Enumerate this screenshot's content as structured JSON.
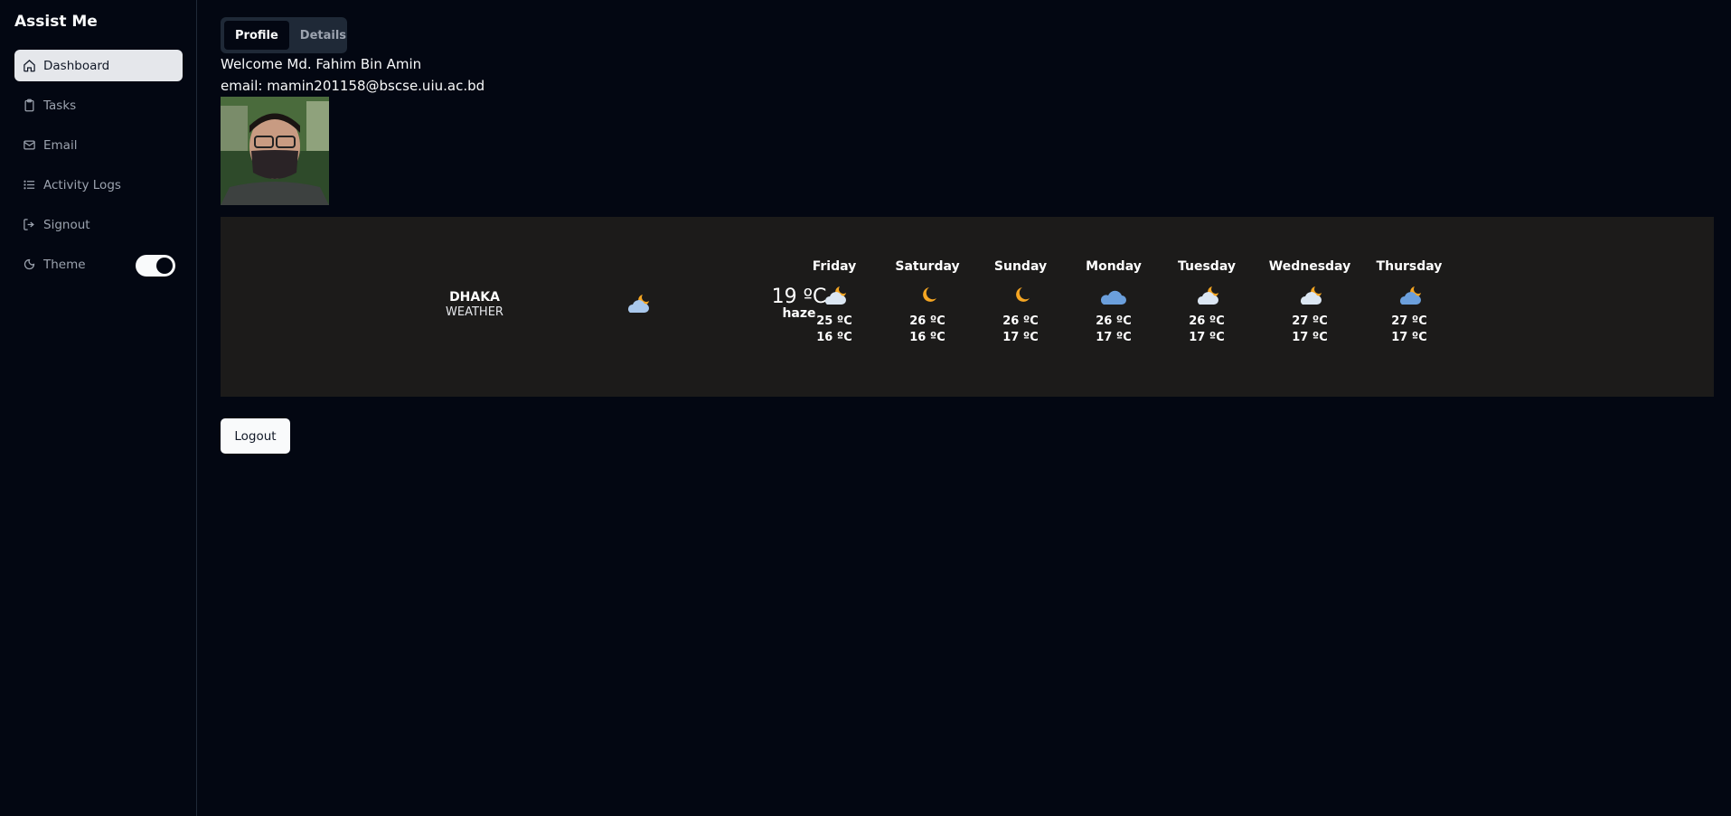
{
  "app": {
    "title": "Assist Me"
  },
  "sidebar": {
    "items": [
      {
        "label": "Dashboard",
        "icon": "home-icon",
        "active": true
      },
      {
        "label": "Tasks",
        "icon": "clipboard-icon"
      },
      {
        "label": "Email",
        "icon": "mail-icon"
      },
      {
        "label": "Activity Logs",
        "icon": "list-icon"
      },
      {
        "label": "Signout",
        "icon": "logout-icon"
      }
    ],
    "theme": {
      "label": "Theme",
      "icon": "moon-sun-icon",
      "enabled": true
    }
  },
  "tabs": [
    {
      "label": "Profile",
      "active": true
    },
    {
      "label": "Details"
    }
  ],
  "profile": {
    "welcome": "Welcome Md. Fahim Bin Amin",
    "email": "email: mamin201158@bscse.uiu.ac.bd"
  },
  "weather": {
    "city": "DHAKA",
    "subtitle": "WEATHER",
    "current": {
      "temp": "19 ºC",
      "description": "haze",
      "icon": "cloud-moon-icon"
    },
    "forecast": [
      {
        "day": "Friday",
        "high": "25 ºC",
        "low": "16 ºC",
        "icon": "cloud-moon-icon"
      },
      {
        "day": "Saturday",
        "high": "26 ºC",
        "low": "16 ºC",
        "icon": "moon-icon"
      },
      {
        "day": "Sunday",
        "high": "26 ºC",
        "low": "17 ºC",
        "icon": "moon-icon"
      },
      {
        "day": "Monday",
        "high": "26 ºC",
        "low": "17 ºC",
        "icon": "cloud-icon"
      },
      {
        "day": "Tuesday",
        "high": "26 ºC",
        "low": "17 ºC",
        "icon": "cloud-moon-icon"
      },
      {
        "day": "Wednesday",
        "high": "27 ºC",
        "low": "17 ºC",
        "icon": "cloud-moon-icon"
      },
      {
        "day": "Thursday",
        "high": "27 ºC",
        "low": "17 ºC",
        "icon": "cloud-moon-icon"
      }
    ]
  },
  "actions": {
    "logout_label": "Logout"
  }
}
